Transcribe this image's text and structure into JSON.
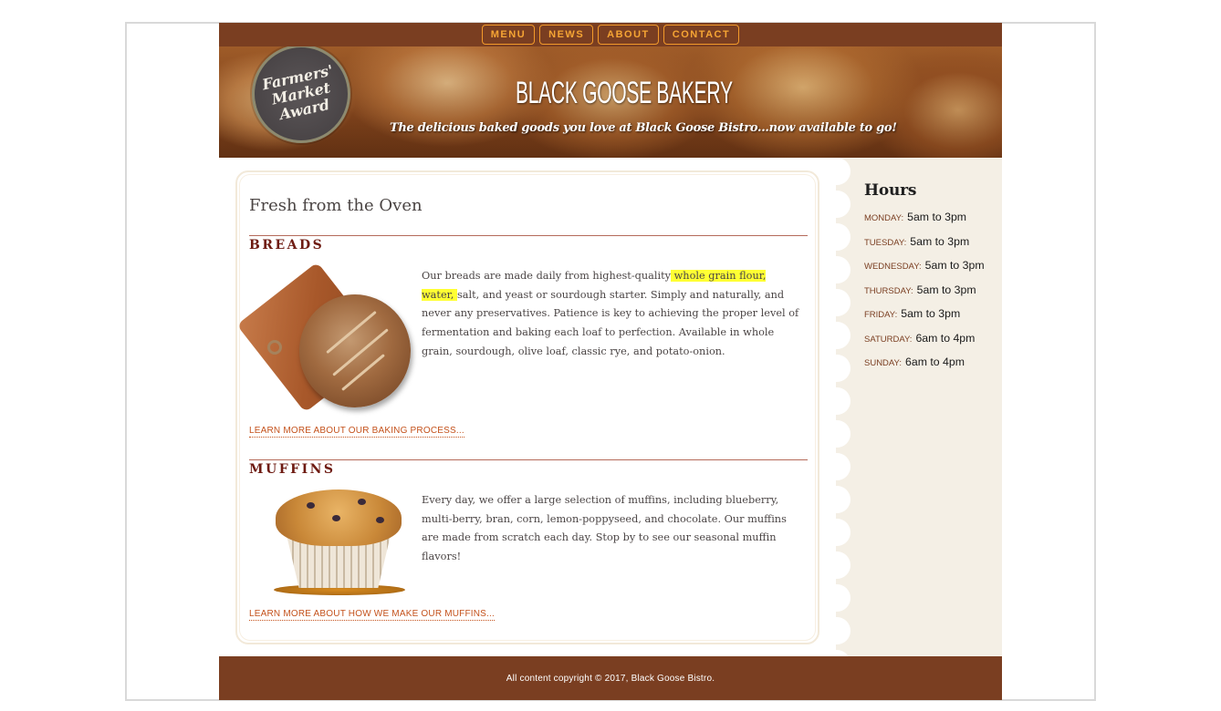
{
  "nav": {
    "items": [
      {
        "label": "MENU"
      },
      {
        "label": "NEWS"
      },
      {
        "label": "ABOUT"
      },
      {
        "label": "CONTACT"
      }
    ]
  },
  "header": {
    "award_lines": [
      "Farmers'",
      "Market",
      "Award"
    ],
    "brand": "BLACK GOOSE BAKERY",
    "tagline": "The delicious baked goods you love at Black Goose Bistro...now available to go!"
  },
  "main": {
    "title": "Fresh from the Oven",
    "breads": {
      "heading": "BREADS",
      "text_before": "Our breads are made daily from highest-quality",
      "highlight": " whole grain flour, water, ",
      "text_after": "salt, and yeast or sourdough starter. Simply and naturally, and never any preservatives. Patience is key to achieving the proper level of fermentation and baking each loaf to perfection. Available in whole grain, sourdough, olive loaf, classic rye, and potato-onion.",
      "link": "Learn more about our baking process..."
    },
    "muffins": {
      "heading": "MUFFINS",
      "text": "Every day, we offer a large selection of muffins, including blueberry, multi-berry, bran, corn, lemon-poppyseed, and chocolate. Our muffins are made from scratch each day. Stop by to see our seasonal muffin flavors!",
      "link": "Learn more about how we make our muffins..."
    }
  },
  "sidebar": {
    "title": "Hours",
    "hours": [
      {
        "day": "Monday:",
        "time": "5am to 3pm"
      },
      {
        "day": "Tuesday:",
        "time": "5am to 3pm"
      },
      {
        "day": "Wednesday:",
        "time": "5am to 3pm"
      },
      {
        "day": "Thursday:",
        "time": "5am to 3pm"
      },
      {
        "day": "Friday:",
        "time": "5am to 3pm"
      },
      {
        "day": "Saturday:",
        "time": "6am to 4pm"
      },
      {
        "day": "Sunday:",
        "time": "6am to 4pm"
      }
    ]
  },
  "footer": {
    "text": "All content copyright © 2017, Black Goose Bistro."
  },
  "colors": {
    "brown": "#7a3e21",
    "nav_orange": "#f6a534",
    "link_orange": "#c4521c",
    "heading_red": "#6e1b12",
    "sidebar_bg": "#f4efe5",
    "highlight": "#ffff33"
  }
}
